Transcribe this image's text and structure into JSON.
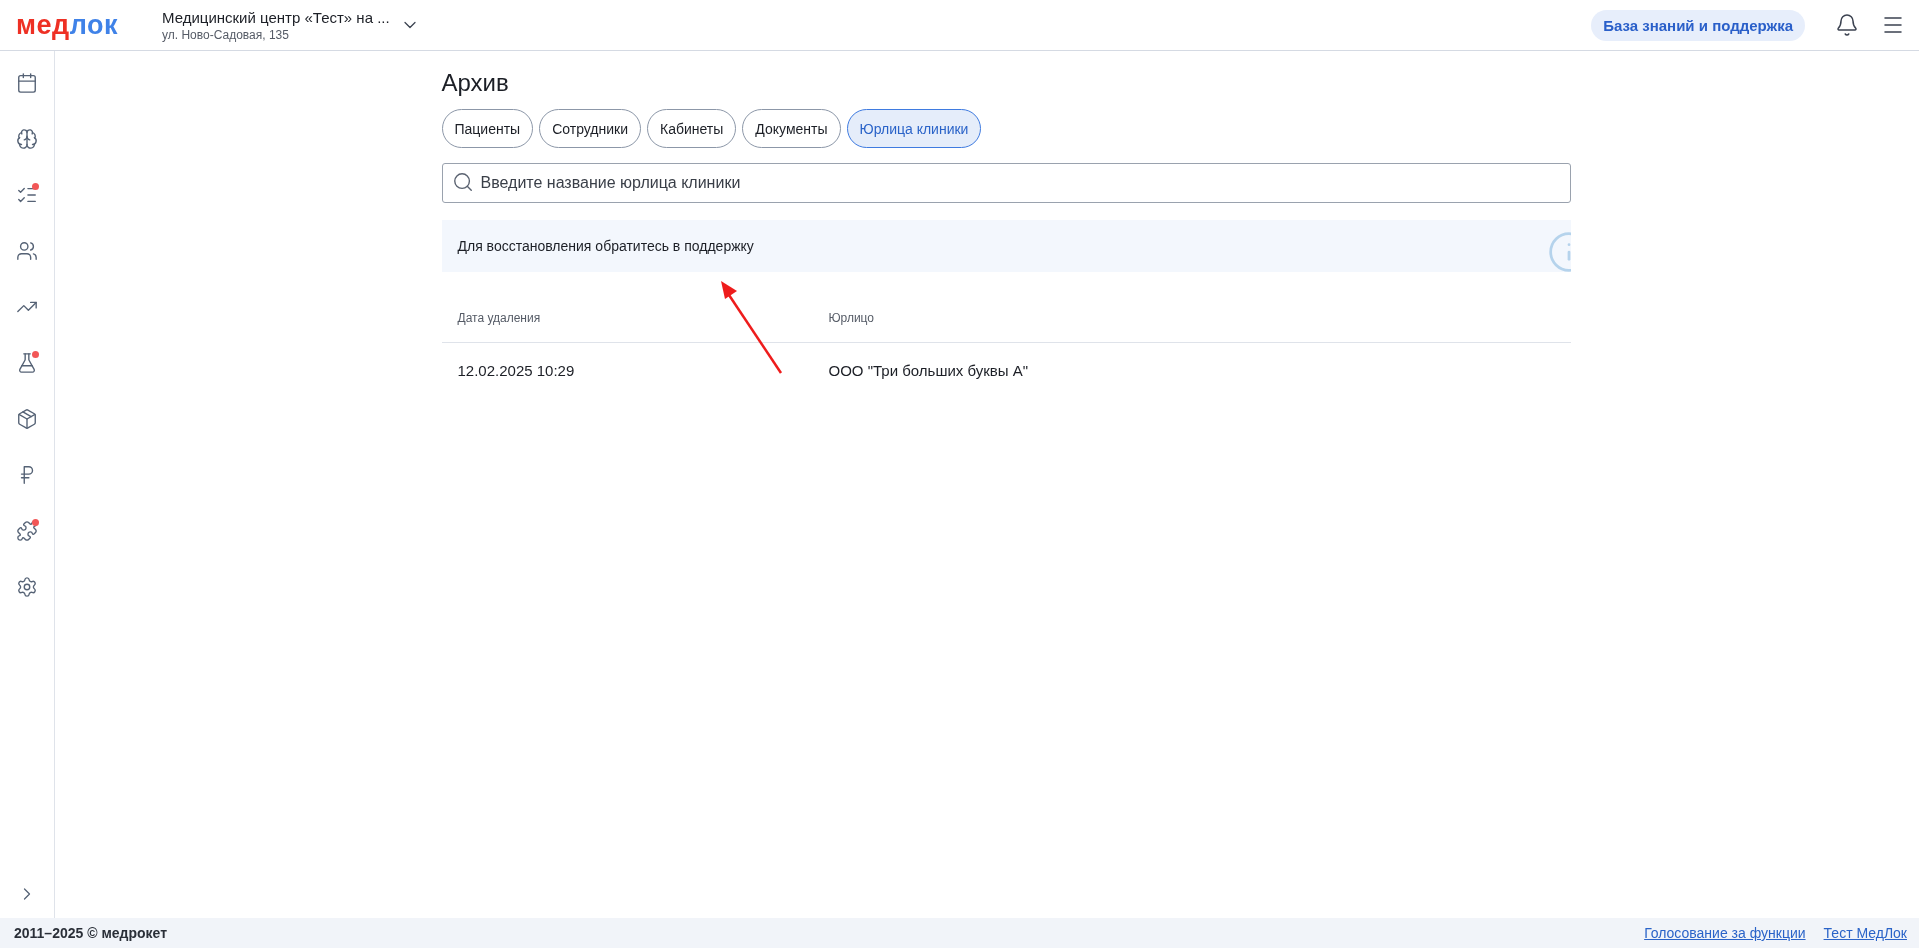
{
  "header": {
    "logo": [
      {
        "text": "мед",
        "color": "#ee3024"
      },
      {
        "text": "лок",
        "color": "#3f82e8"
      }
    ],
    "clinic": {
      "name": "Медицинский центр «Тест» на ...",
      "address": "ул. Ново-Садовая, 135"
    },
    "support_button": "База знаний и поддержка"
  },
  "sidebar": {
    "items": [
      {
        "kind": "calendar",
        "badge": false
      },
      {
        "kind": "brain",
        "badge": false
      },
      {
        "kind": "tasks",
        "badge": true
      },
      {
        "kind": "users",
        "badge": false
      },
      {
        "kind": "chart",
        "badge": false
      },
      {
        "kind": "lab",
        "badge": true
      },
      {
        "kind": "box",
        "badge": false
      },
      {
        "kind": "ruble",
        "badge": false
      },
      {
        "kind": "puzzle",
        "badge": true
      },
      {
        "kind": "settings",
        "badge": false
      }
    ]
  },
  "page": {
    "title": "Архив",
    "tabs": [
      {
        "label": "Пациенты",
        "selected": false
      },
      {
        "label": "Сотрудники",
        "selected": false
      },
      {
        "label": "Кабинеты",
        "selected": false
      },
      {
        "label": "Документы",
        "selected": false
      },
      {
        "label": "Юрлица клиники",
        "selected": true
      }
    ],
    "search": {
      "placeholder": "Введите название юрлица клиники"
    },
    "notice": "Для восстановления обратитесь в поддержку",
    "table": {
      "columns": [
        "Дата удаления",
        "Юрлицо"
      ],
      "rows": [
        [
          "12.02.2025 10:29",
          "ООО \"Три больших буквы А\""
        ]
      ]
    }
  },
  "footer": {
    "copyright": "2011–2025 © медрокет",
    "links": [
      "Голосование за функции",
      "Тест МедЛок"
    ]
  }
}
